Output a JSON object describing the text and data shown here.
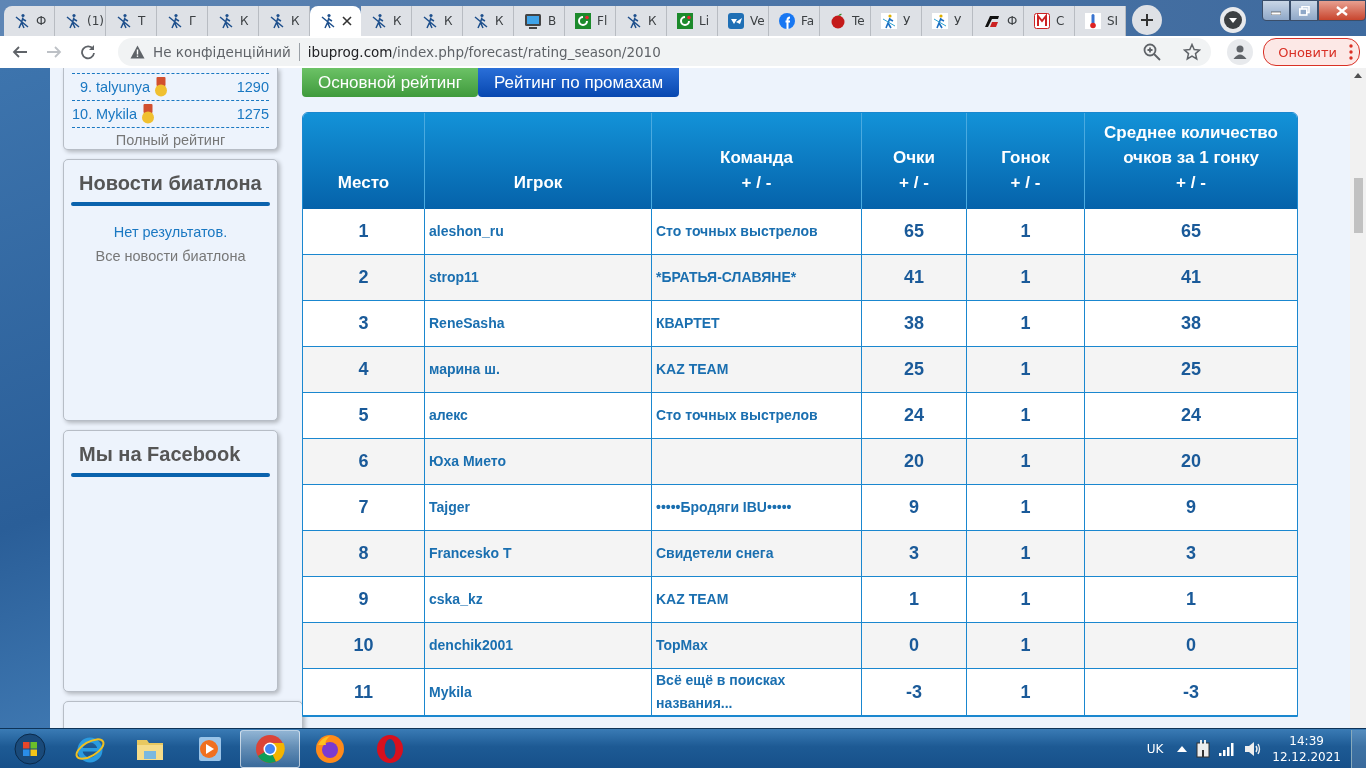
{
  "browser": {
    "tabs": [
      {
        "title": "Ф",
        "selected": false
      },
      {
        "title": "(1)",
        "selected": false
      },
      {
        "title": "Т",
        "selected": false
      },
      {
        "title": "Г",
        "selected": false
      },
      {
        "title": "К",
        "selected": false
      },
      {
        "title": "К",
        "selected": false
      },
      {
        "selected": true
      },
      {
        "title": "К",
        "selected": false
      },
      {
        "title": "К",
        "selected": false
      },
      {
        "title": "К",
        "selected": false
      },
      {
        "title": "В",
        "selected": false
      },
      {
        "title": "Fl",
        "selected": false
      },
      {
        "title": "К",
        "selected": false
      },
      {
        "title": "Li",
        "selected": false
      },
      {
        "title": "Ve",
        "selected": false
      },
      {
        "title": "Fa",
        "selected": false
      },
      {
        "title": "Te",
        "selected": false
      },
      {
        "title": "У",
        "selected": false
      },
      {
        "title": "У",
        "selected": false
      },
      {
        "title": "Ф",
        "selected": false
      },
      {
        "title": "С",
        "selected": false
      },
      {
        "title": "SI",
        "selected": false
      }
    ],
    "address_bar": {
      "security": "Не конфіденційний",
      "domain": "ibuprog.com",
      "path": "/index.php/forecast/rating_season/2010"
    },
    "update_button": "Оновити"
  },
  "sidebar": {
    "rating": {
      "rows": [
        {
          "rank": "9.",
          "name": "talyunya",
          "points": "1290"
        },
        {
          "rank": "10.",
          "name": "Mykila",
          "points": "1275"
        }
      ],
      "link": "Полный рейтинг"
    },
    "news": {
      "title": "Новости биатлона",
      "empty": "Нет результатов.",
      "link": "Все новости биатлона"
    },
    "facebook": {
      "title": "Мы на Facebook"
    }
  },
  "rating_tabs": [
    {
      "label": "Основной рейтинг",
      "selected": true
    },
    {
      "label": "Рейтинг по промахам",
      "selected": false
    }
  ],
  "table": {
    "columns": [
      {
        "label": "Место"
      },
      {
        "label": "Игрок"
      },
      {
        "label": "Команда",
        "sort": "+ / -"
      },
      {
        "label": "Очки",
        "sort": "+ / -"
      },
      {
        "label": "Гонок",
        "sort": "+ / -"
      },
      {
        "label": "Среднее количество очков за 1 гонку",
        "sort": "+ / -"
      }
    ],
    "rows": [
      {
        "place": "1",
        "player": "aleshon_ru",
        "team": "Сто точных выстрелов",
        "points": "65",
        "races": "1",
        "average": "65"
      },
      {
        "place": "2",
        "player": "strop11",
        "team": "*БРАТЬЯ-СЛАВЯНЕ*",
        "points": "41",
        "races": "1",
        "average": "41"
      },
      {
        "place": "3",
        "player": "ReneSasha",
        "team": "КВАРТЕТ",
        "points": "38",
        "races": "1",
        "average": "38"
      },
      {
        "place": "4",
        "player": "марина ш.",
        "team": "KAZ TEAM",
        "points": "25",
        "races": "1",
        "average": "25"
      },
      {
        "place": "5",
        "player": "алекс",
        "team": "Сто точных выстрелов",
        "points": "24",
        "races": "1",
        "average": "24"
      },
      {
        "place": "6",
        "player": "Юха Мието",
        "points": "20",
        "races": "1",
        "average": "20"
      },
      {
        "place": "7",
        "player": "Tajger",
        "team": "•••••Бродяги IBU•••••",
        "points": "9",
        "races": "1",
        "average": "9"
      },
      {
        "place": "8",
        "player": "Francesko T",
        "team": "Свидетели снега",
        "points": "3",
        "races": "1",
        "average": "3"
      },
      {
        "place": "9",
        "player": "cska_kz",
        "team": "KAZ TEAM",
        "points": "1",
        "races": "1",
        "average": "1"
      },
      {
        "place": "10",
        "player": "denchik2001",
        "team": "TopMax",
        "points": "0",
        "races": "1",
        "average": "0"
      },
      {
        "place": "11",
        "player": "Mykila",
        "team": "Всё ещё в поисках названия...",
        "points": "-3",
        "races": "1",
        "average": "-3"
      }
    ]
  },
  "taskbar": {
    "language": "UK",
    "time": "14:39",
    "date": "12.12.2021"
  }
}
